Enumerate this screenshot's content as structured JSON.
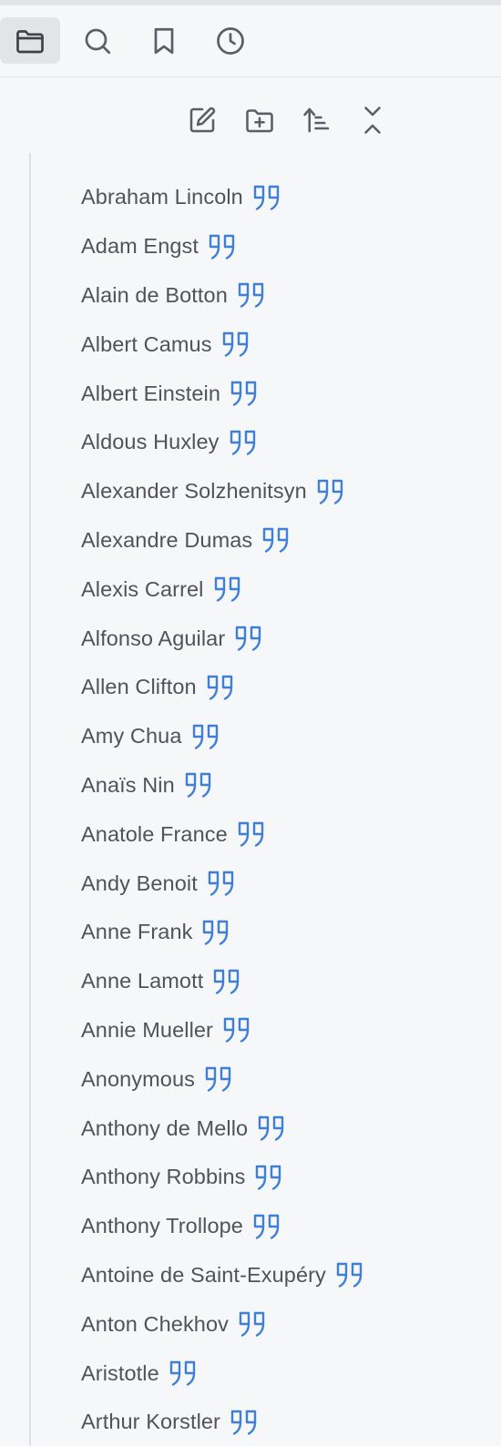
{
  "colors": {
    "background": "#f6f7f9",
    "icon_stroke": "#5a5e66",
    "text": "#4f535a",
    "quote_accent": "#3f7fd6",
    "active_tab_bg": "#e3e4e7"
  },
  "tabs": [
    {
      "name": "files",
      "icon": "folder-icon",
      "active": true
    },
    {
      "name": "search",
      "icon": "search-icon",
      "active": false
    },
    {
      "name": "bookmarks",
      "icon": "bookmark-icon",
      "active": false
    },
    {
      "name": "recent",
      "icon": "clock-icon",
      "active": false
    }
  ],
  "toolbar": {
    "buttons": [
      {
        "name": "new-note",
        "icon": "edit-icon"
      },
      {
        "name": "new-folder",
        "icon": "folder-plus-icon"
      },
      {
        "name": "sort",
        "icon": "sort-ascending-icon"
      },
      {
        "name": "collapse-all",
        "icon": "collapse-icon"
      }
    ]
  },
  "tree": {
    "items": [
      {
        "label": "Abraham Lincoln",
        "icon": "quote-icon"
      },
      {
        "label": "Adam Engst",
        "icon": "quote-icon"
      },
      {
        "label": "Alain de Botton",
        "icon": "quote-icon"
      },
      {
        "label": "Albert Camus",
        "icon": "quote-icon"
      },
      {
        "label": "Albert Einstein",
        "icon": "quote-icon"
      },
      {
        "label": "Aldous Huxley",
        "icon": "quote-icon"
      },
      {
        "label": "Alexander Solzhenitsyn",
        "icon": "quote-icon"
      },
      {
        "label": "Alexandre Dumas",
        "icon": "quote-icon"
      },
      {
        "label": "Alexis Carrel",
        "icon": "quote-icon"
      },
      {
        "label": "Alfonso Aguilar",
        "icon": "quote-icon"
      },
      {
        "label": "Allen Clifton",
        "icon": "quote-icon"
      },
      {
        "label": "Amy Chua",
        "icon": "quote-icon"
      },
      {
        "label": "Anaïs Nin",
        "icon": "quote-icon"
      },
      {
        "label": "Anatole France",
        "icon": "quote-icon"
      },
      {
        "label": "Andy Benoit",
        "icon": "quote-icon"
      },
      {
        "label": "Anne Frank",
        "icon": "quote-icon"
      },
      {
        "label": "Anne Lamott",
        "icon": "quote-icon"
      },
      {
        "label": "Annie Mueller",
        "icon": "quote-icon"
      },
      {
        "label": "Anonymous",
        "icon": "quote-icon"
      },
      {
        "label": "Anthony de Mello",
        "icon": "quote-icon"
      },
      {
        "label": "Anthony Robbins",
        "icon": "quote-icon"
      },
      {
        "label": "Anthony Trollope",
        "icon": "quote-icon"
      },
      {
        "label": "Antoine de Saint-Exupéry",
        "icon": "quote-icon"
      },
      {
        "label": "Anton Chekhov",
        "icon": "quote-icon"
      },
      {
        "label": "Aristotle",
        "icon": "quote-icon"
      },
      {
        "label": "Arthur Korstler",
        "icon": "quote-icon"
      }
    ]
  }
}
